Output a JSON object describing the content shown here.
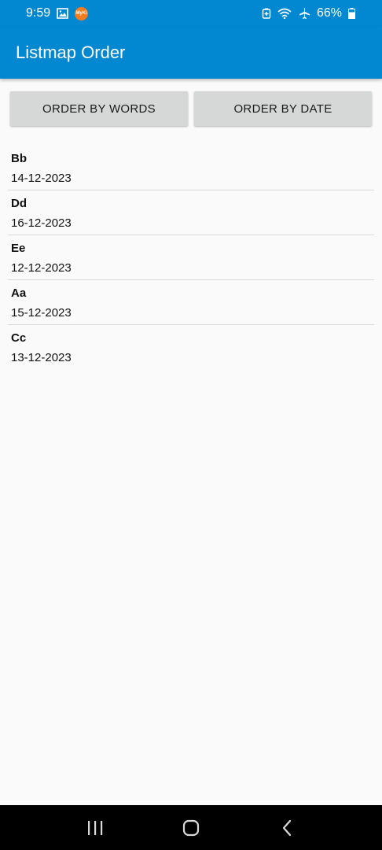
{
  "status_bar": {
    "time": "9:59",
    "battery": "66%",
    "app_badge": "MyKi"
  },
  "app_bar": {
    "title": "Listmap Order"
  },
  "buttons": {
    "order_by_words": "ORDER BY WORDS",
    "order_by_date": "ORDER BY DATE"
  },
  "list": {
    "items": [
      {
        "word": "Bb",
        "date": "14-12-2023"
      },
      {
        "word": "Dd",
        "date": "16-12-2023"
      },
      {
        "word": "Ee",
        "date": "12-12-2023"
      },
      {
        "word": "Aa",
        "date": "15-12-2023"
      },
      {
        "word": "Cc",
        "date": "13-12-2023"
      }
    ]
  },
  "colors": {
    "primary": "#0288d1",
    "background": "#fafafa",
    "button": "#d6d7d7",
    "nav_bar": "#000000"
  },
  "icons": {
    "status_left": [
      "gallery-icon",
      "app-notification-icon"
    ],
    "status_right": [
      "battery-saver-icon",
      "wifi-icon",
      "airplane-mode-icon",
      "battery-icon"
    ],
    "nav": [
      "recents-icon",
      "home-icon",
      "back-icon"
    ]
  }
}
